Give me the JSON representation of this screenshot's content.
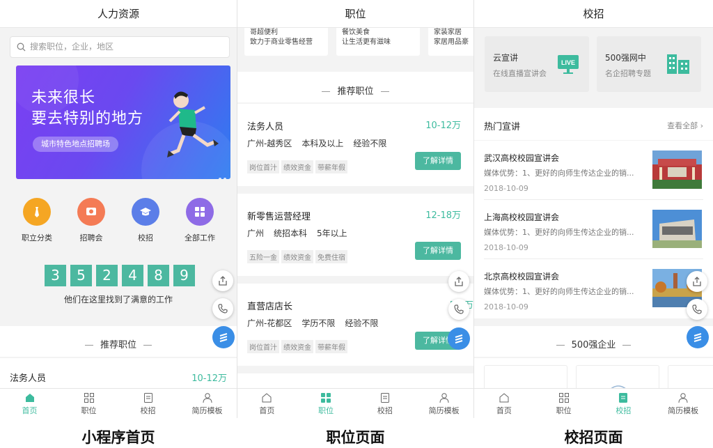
{
  "screen_home": {
    "nav_title": "人力资源",
    "search_placeholder": "搜索职位，企业，地区",
    "banner": {
      "line1": "未来很长",
      "line2": "要去特别的地方",
      "pill": "城市特色地点招聘场"
    },
    "categories": [
      {
        "label": "职立分类",
        "color": "#f5a623",
        "icon": "tie-icon"
      },
      {
        "label": "招聘会",
        "color": "#f47b55",
        "icon": "fair-icon"
      },
      {
        "label": "校招",
        "color": "#5b7ee8",
        "icon": "graduation-icon"
      },
      {
        "label": "全部工作",
        "color": "#8e6be6",
        "icon": "grid-icon"
      }
    ],
    "counter_digits": [
      "3",
      "5",
      "2",
      "4",
      "8",
      "9"
    ],
    "counter_text": "他们在这里找到了满意的工作",
    "section_title": "推荐职位",
    "preview_job": {
      "title": "法务人员",
      "salary": "10-12万"
    },
    "tabs": [
      "首页",
      "职位",
      "校招",
      "简历模板"
    ],
    "caption": "小程序首页"
  },
  "screen_jobs": {
    "nav_title": "职位",
    "top_cards": [
      {
        "line1": "哥超便利",
        "line2": "致力于商业零售经营"
      },
      {
        "line1": "餐饮美食",
        "line2": "让生活更有滋味"
      },
      {
        "line1": "家装家居",
        "line2": "家居用品豪"
      }
    ],
    "section_title": "推荐职位",
    "jobs": [
      {
        "title": "法务人员",
        "salary": "10-12万",
        "meta": [
          "广州-越秀区",
          "本科及以上",
          "经验不限"
        ],
        "tags": [
          "岗位首汁",
          "绩效资金",
          "带薪年假"
        ],
        "button": "了解详情"
      },
      {
        "title": "新零售运营经理",
        "salary": "12-18万",
        "meta": [
          "广州",
          "统招本科",
          "5年以上"
        ],
        "tags": [
          "五险一金",
          "绩效资金",
          "免费住宿"
        ],
        "button": "了解详情"
      },
      {
        "title": "直营店店长",
        "salary": "5-8万",
        "meta": [
          "广州-花都区",
          "学历不限",
          "经验不限"
        ],
        "tags": [
          "岗位首汁",
          "绩效资金",
          "带薪年假"
        ],
        "button": "了解详情"
      }
    ],
    "tabs": [
      "首页",
      "职位",
      "校招",
      "简历模板"
    ],
    "caption": "职位页面"
  },
  "screen_campus": {
    "nav_title": "校招",
    "boxes": [
      {
        "title": "云宣讲",
        "sub": "在线直播宣讲会",
        "icon": "live-icon",
        "badge": "LIVE"
      },
      {
        "title": "500强网中",
        "sub": "名企招聘专题",
        "icon": "building-icon"
      }
    ],
    "hot_title": "热门宣讲",
    "view_all": "查看全部",
    "talks": [
      {
        "title": "武汉高校校园宣讲会",
        "desc": "媒体优势：1、更好的向师生传达企业的销...",
        "date": "2018-10-09"
      },
      {
        "title": "上海高校校园宣讲会",
        "desc": "媒体优势：1、更好的向师生传达企业的销...",
        "date": "2018-10-09"
      },
      {
        "title": "北京高校校园宣讲会",
        "desc": "媒体优势：1、更好的向师生传达企业的销...",
        "date": "2018-10-09"
      }
    ],
    "section_title": "500强企业",
    "tabs": [
      "首页",
      "职位",
      "校招",
      "简历模板"
    ],
    "caption": "校招页面"
  }
}
